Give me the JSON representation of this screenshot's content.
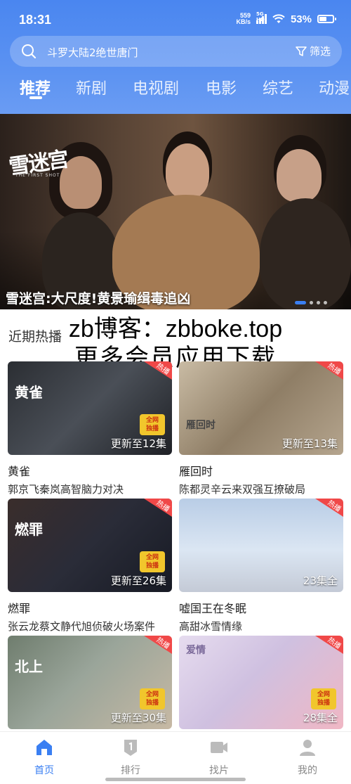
{
  "status_bar": {
    "time": "18:31",
    "net_speed_value": "559",
    "net_speed_unit": "KB/s",
    "signal_label": "5G HD",
    "battery_pct": "53%",
    "battery_level": 0.53
  },
  "search": {
    "text": "斗罗大陆2绝世唐门",
    "filter_label": "筛选"
  },
  "tabs": [
    {
      "label": "推荐",
      "active": true
    },
    {
      "label": "新剧"
    },
    {
      "label": "电视剧"
    },
    {
      "label": "电影"
    },
    {
      "label": "综艺"
    },
    {
      "label": "动漫"
    }
  ],
  "banner": {
    "logo_text": "雪迷宫",
    "logo_sub": "THE FIRST SHOT",
    "title": "雪迷宫:大尺度!黄景瑜缉毒追凶",
    "slide_count": 5,
    "active_slide": 0
  },
  "section": {
    "title": "近期热播"
  },
  "watermark": {
    "line1": "zb博客：zbboke.top",
    "line2": "更多会员应用下载"
  },
  "cards": [
    {
      "title": "黄雀",
      "desc": "郭京飞秦岚高智脑力对决",
      "episode": "更新至12集",
      "hot": "热播",
      "quanwang": "全网\n独播",
      "logo": "黄雀",
      "color": "#3b3f45"
    },
    {
      "title": "雁回时",
      "desc": "陈都灵辛云来双强互撩破局",
      "episode": "更新至13集",
      "hot": "热播",
      "logo": "雁回时",
      "color": "#a08f7a"
    },
    {
      "title": "燃罪",
      "desc": "张云龙蔡文静代旭侦破火场案件",
      "episode": "更新至26集",
      "hot": "热播",
      "quanwang": "全网\n独播",
      "logo": "燃罪",
      "color": "#2b2a30"
    },
    {
      "title": "嘘国王在冬眠",
      "desc": "高甜冰雪情缘",
      "episode": "23集全",
      "hot": "热播",
      "logo": "",
      "color": "#9bb6d6"
    },
    {
      "title": "",
      "desc": "",
      "episode": "更新至30集",
      "hot": "热播",
      "quanwang": "全网\n独播",
      "logo": "北上",
      "color": "#7c8a7a"
    },
    {
      "title": "",
      "desc": "",
      "episode": "28集全",
      "hot": "热播",
      "quanwang": "全网\n独播",
      "logo": "爱情",
      "color": "#d9cfe6"
    }
  ],
  "bottom_nav": [
    {
      "label": "首页",
      "icon": "home-icon",
      "active": true
    },
    {
      "label": "排行",
      "icon": "ranking-icon"
    },
    {
      "label": "找片",
      "icon": "video-camera-icon"
    },
    {
      "label": "我的",
      "icon": "profile-icon"
    }
  ],
  "colors": {
    "accent": "#3a7ff2",
    "header": "#4a86f0",
    "hot_badge": "#f04848"
  }
}
